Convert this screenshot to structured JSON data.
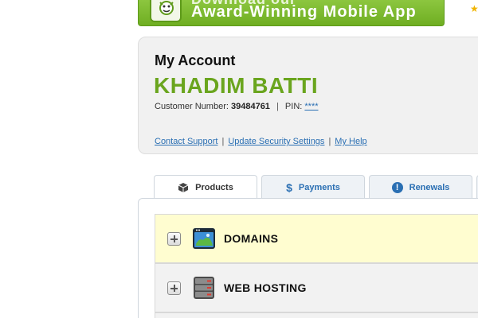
{
  "banner": {
    "top_text": "Download our",
    "text": "Award-Winning Mobile App",
    "icon": "go-daddy-mascot-icon"
  },
  "account": {
    "title": "My Account",
    "name": "KHADIM BATTI",
    "customer_number_label": "Customer Number:",
    "customer_number": "39484761",
    "pin_label": "PIN:",
    "pin_value": "****",
    "links": [
      "Contact Support",
      "Update Security Settings",
      "My Help"
    ]
  },
  "tabs": [
    {
      "label": "Products",
      "icon": "box-icon",
      "active": true
    },
    {
      "label": "Payments",
      "icon": "dollar-icon",
      "active": false
    },
    {
      "label": "Renewals",
      "icon": "alert-icon",
      "active": false
    }
  ],
  "products": [
    {
      "label": "DOMAINS",
      "icon": "globe-icon"
    },
    {
      "label": "WEB HOSTING",
      "icon": "server-icon"
    }
  ],
  "colors": {
    "accent_green": "#6aa51e",
    "link_blue": "#2a6fb3",
    "domains_row_bg": "#fffdd0"
  }
}
